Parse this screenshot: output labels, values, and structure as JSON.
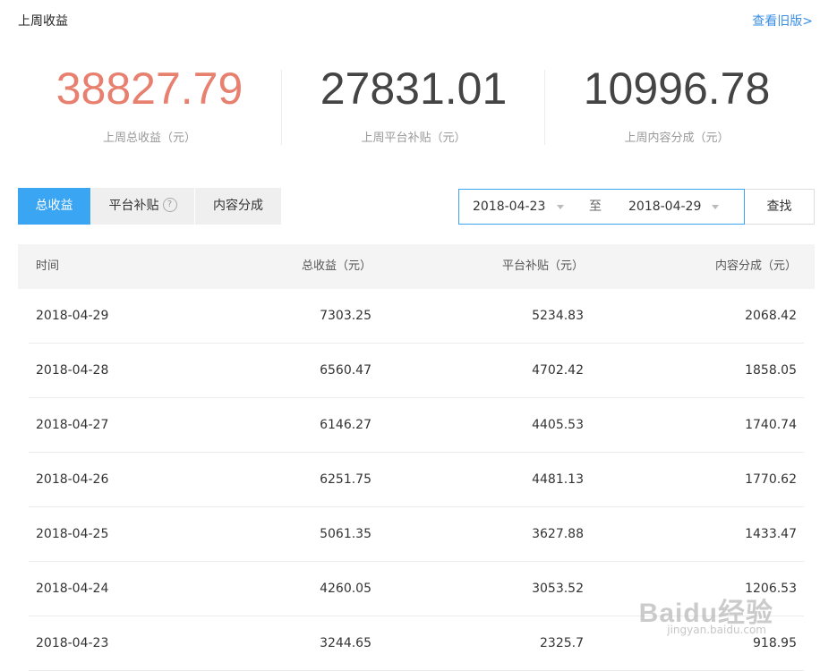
{
  "header": {
    "title": "上周收益",
    "old_version_link": "查看旧版>"
  },
  "stats": [
    {
      "value": "38827.79",
      "label": "上周总收益（元）",
      "color": "#e8806f"
    },
    {
      "value": "27831.01",
      "label": "上周平台补贴（元）",
      "color": "#444444"
    },
    {
      "value": "10996.78",
      "label": "上周内容分成（元）",
      "color": "#444444"
    }
  ],
  "tabs": [
    {
      "label": "总收益",
      "active": true
    },
    {
      "label": "平台补贴",
      "active": false,
      "help_icon": "?"
    },
    {
      "label": "内容分成",
      "active": false
    }
  ],
  "date_filter": {
    "start": "2018-04-23",
    "separator": "至",
    "end": "2018-04-29",
    "search_label": "查找"
  },
  "table": {
    "columns": [
      "时间",
      "总收益（元）",
      "平台补贴（元）",
      "内容分成（元）"
    ],
    "rows": [
      [
        "2018-04-29",
        "7303.25",
        "5234.83",
        "2068.42"
      ],
      [
        "2018-04-28",
        "6560.47",
        "4702.42",
        "1858.05"
      ],
      [
        "2018-04-27",
        "6146.27",
        "4405.53",
        "1740.74"
      ],
      [
        "2018-04-26",
        "6251.75",
        "4481.13",
        "1770.62"
      ],
      [
        "2018-04-25",
        "5061.35",
        "3627.88",
        "1433.47"
      ],
      [
        "2018-04-24",
        "4260.05",
        "3053.52",
        "1206.53"
      ],
      [
        "2018-04-23",
        "3244.65",
        "2325.7",
        "918.95"
      ]
    ]
  },
  "watermark": {
    "text": "Baidu经验",
    "sub": "jingyan.baidu.com"
  },
  "colors": {
    "accent": "#39a5f3",
    "highlight": "#e8806f",
    "link": "#3a8ee6"
  }
}
